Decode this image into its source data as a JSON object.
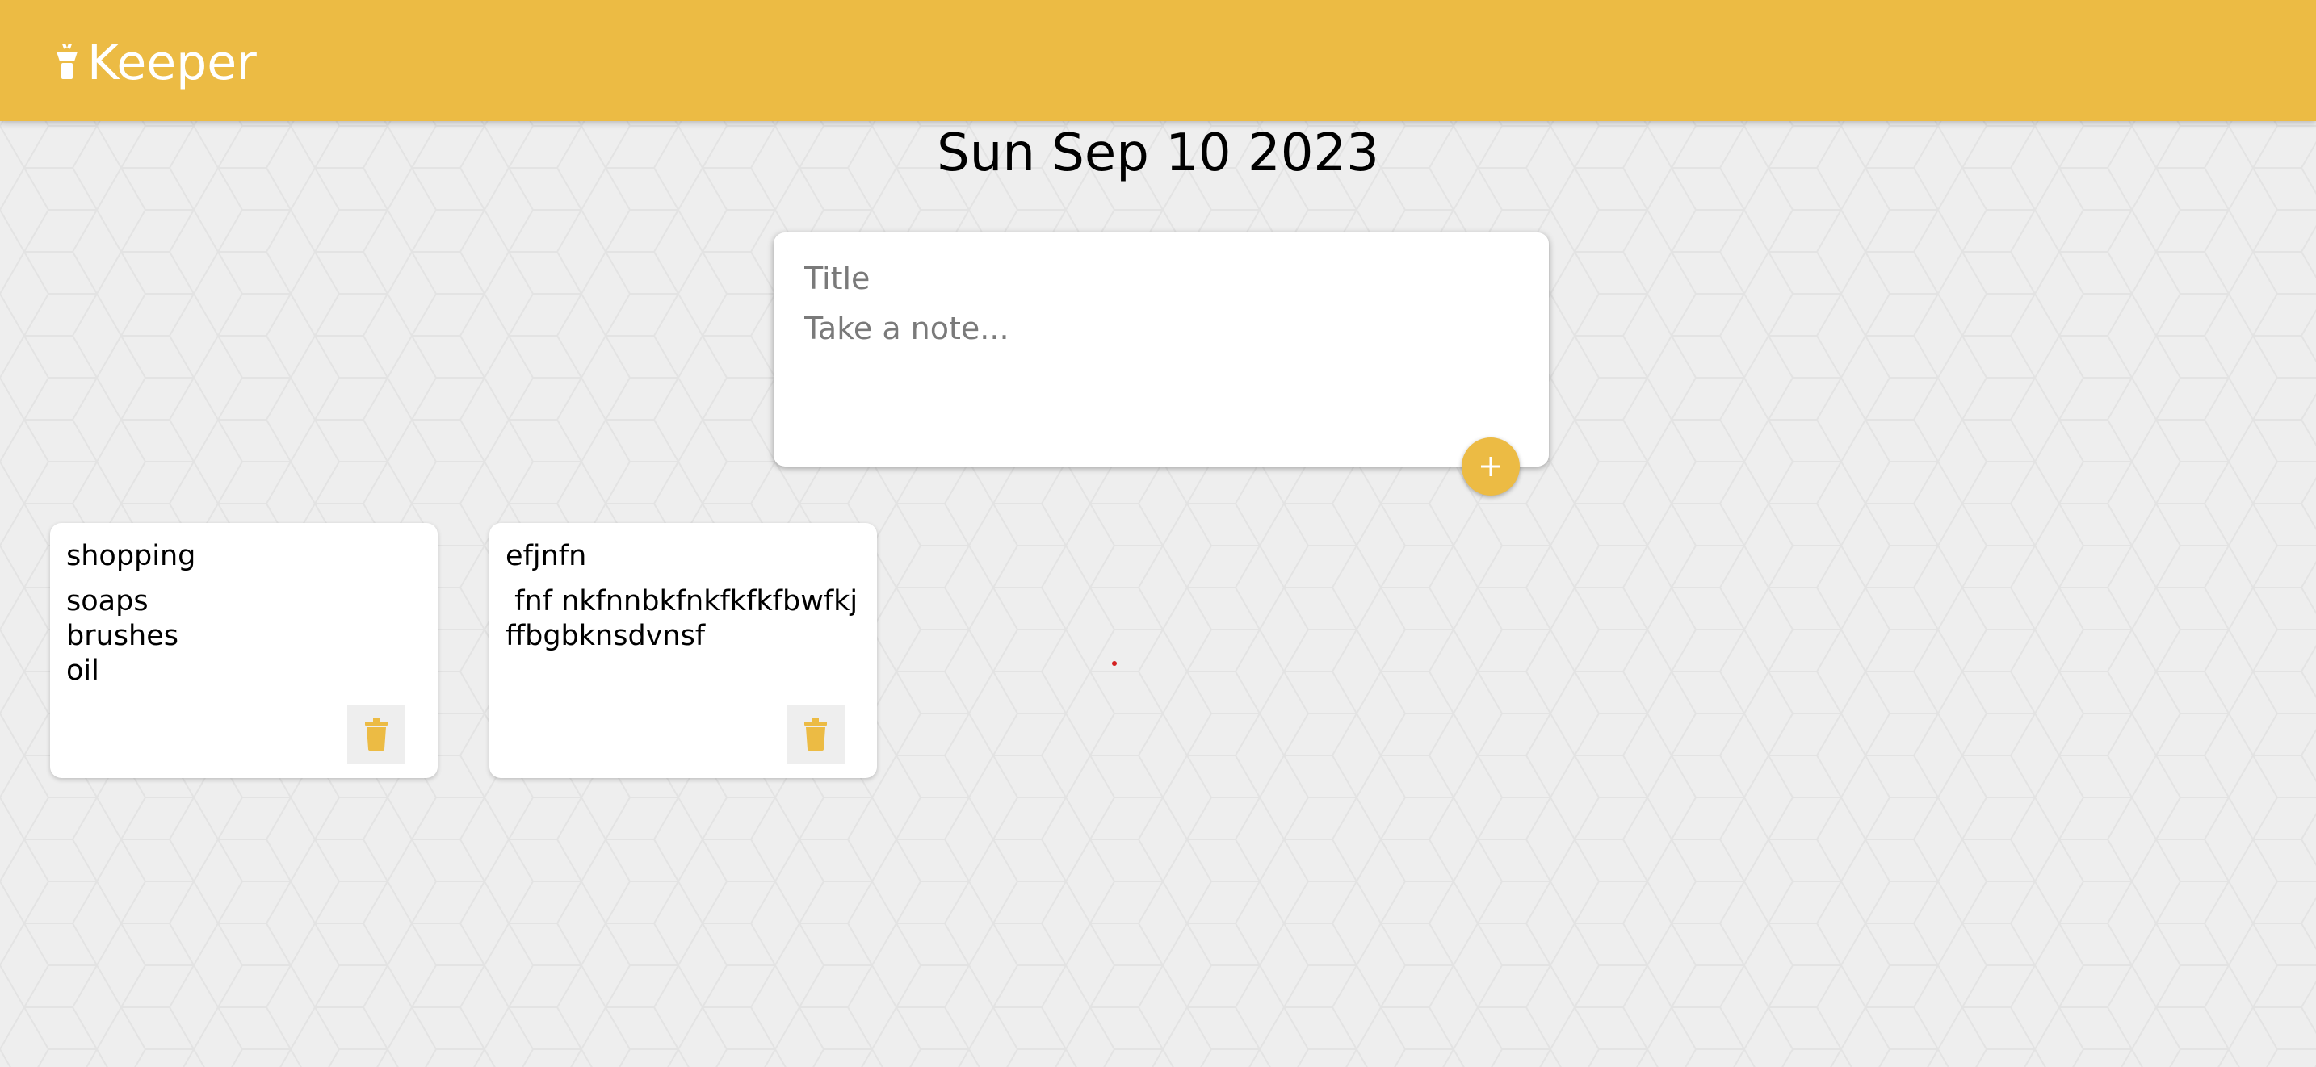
{
  "header": {
    "brand_title": "Keeper",
    "brand_icon": "highlighter-icon",
    "accent_color": "#ecbb44"
  },
  "date_heading": "Sun Sep 10 2023",
  "composer": {
    "title_placeholder": "Title",
    "body_placeholder": "Take a note...",
    "title_value": "",
    "body_value": "",
    "add_icon": "plus-icon"
  },
  "notes": [
    {
      "title": "shopping",
      "content": "soaps\nbrushes\noil",
      "delete_icon": "trash-icon"
    },
    {
      "title": "efjnfn",
      "content": " fnf nkfnnbkfnkfkfkfbwfkjffbgbknsdvnsf",
      "delete_icon": "trash-icon"
    }
  ]
}
